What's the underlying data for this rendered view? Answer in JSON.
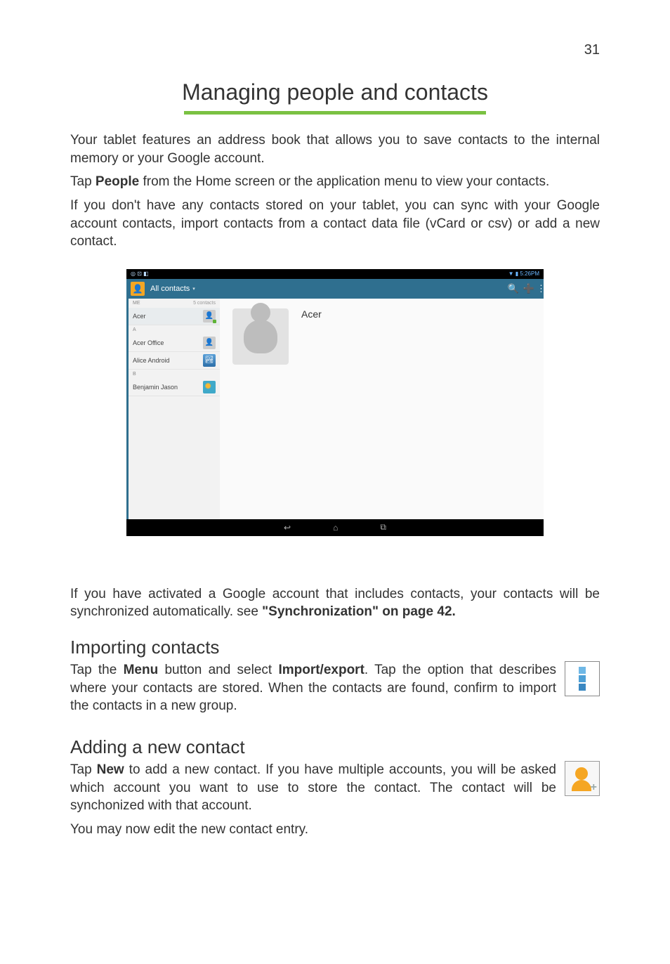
{
  "page_number": "31",
  "title": "Managing people and contacts",
  "para1": "Your tablet features an address book that allows you to save contacts to the internal memory or your Google account.",
  "para2_a": "Tap ",
  "para2_b": "People",
  "para2_c": " from the Home screen or the application menu to view your contacts.",
  "para3": "If you don't have any contacts stored on your tablet, you can sync with your Google account contacts, import contacts from a contact data file (vCard or csv) or add a new contact.",
  "screenshot": {
    "status_left": "◎ ⊡ ◧",
    "status_right": "▼ ▮ 5:26PM",
    "topbar_label": "All contacts",
    "count_label": "5 contacts",
    "me_header": "ME",
    "a_header": "A",
    "b_header": "B",
    "items": {
      "acer": "Acer",
      "acer_office": "Acer Office",
      "alice": "Alice Android",
      "benjamin": "Benjamin Jason"
    },
    "detail_name": "Acer"
  },
  "para4_a": "If you have activated a Google account that includes contacts, your contacts will be synchronized automatically. see ",
  "para4_b": "\"Synchronization\" on page 42.",
  "section_import": "Importing contacts",
  "import_a": "Tap the ",
  "import_b": "Menu",
  "import_c": " button and select ",
  "import_d": "Import/export",
  "import_e": ". Tap the option that describes where your contacts are stored. When the contacts are found, confirm to import the contacts in a new group.",
  "section_add": "Adding a new contact",
  "add_a": "Tap ",
  "add_b": "New",
  "add_c": " to add a new contact. If you have multiple accounts, you will be asked which account you want to use to store the contact. The contact will be synchonized with that account.",
  "add_last": "You may now edit the new contact entry."
}
